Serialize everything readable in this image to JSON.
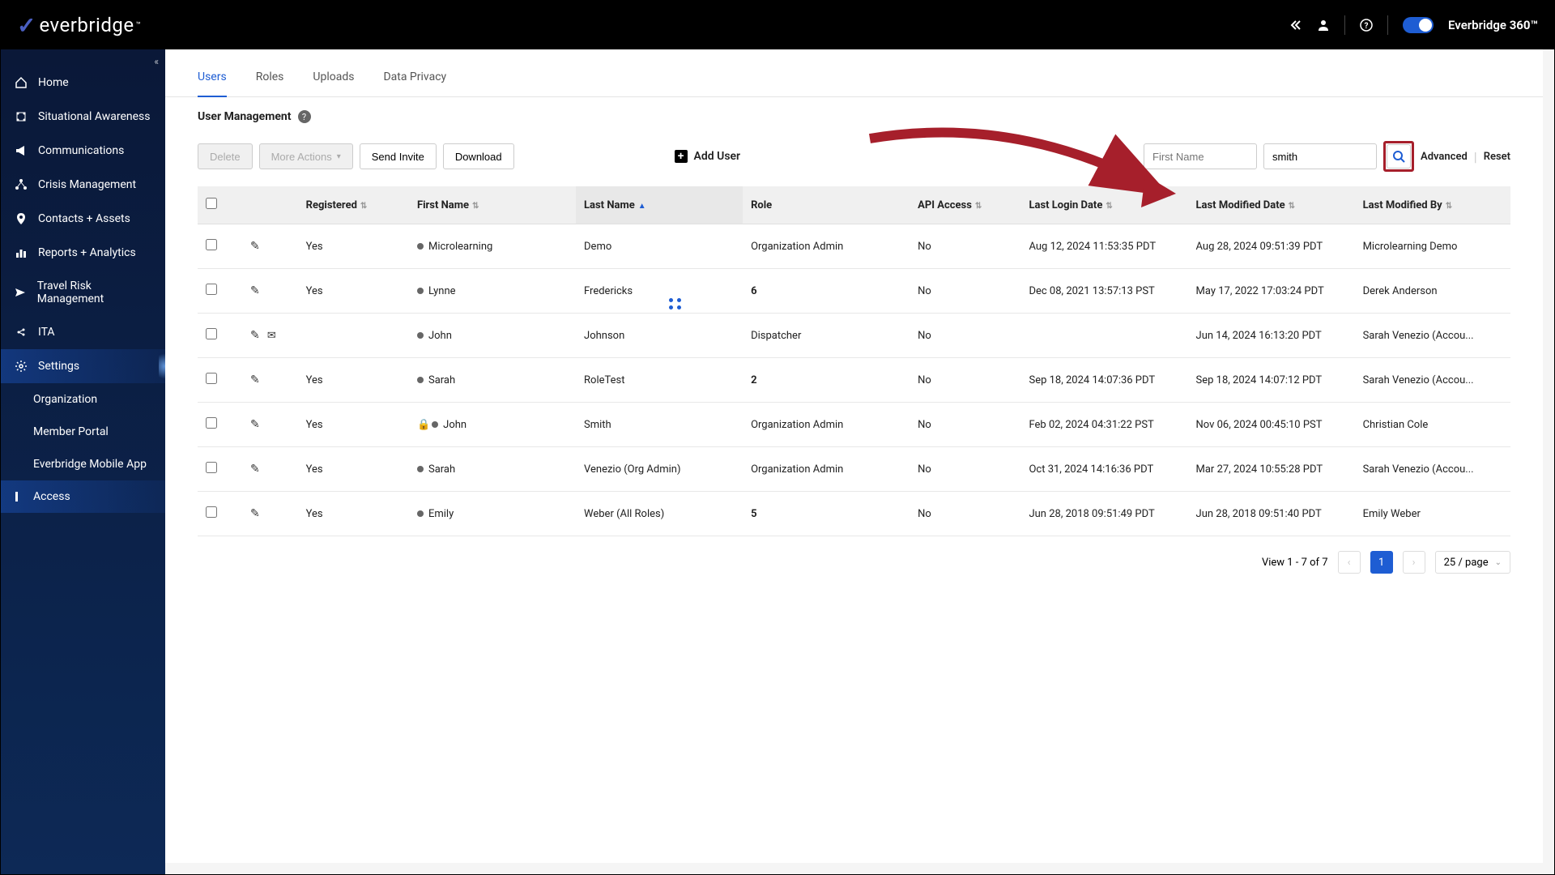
{
  "brand": {
    "name": "everbridge",
    "toggle_label": "Everbridge",
    "toggle_suffix": "360™"
  },
  "sidebar": {
    "items": [
      {
        "label": "Home",
        "icon": "home"
      },
      {
        "label": "Situational Awareness",
        "icon": "map"
      },
      {
        "label": "Communications",
        "icon": "bullhorn"
      },
      {
        "label": "Crisis Management",
        "icon": "network"
      },
      {
        "label": "Contacts + Assets",
        "icon": "pin"
      },
      {
        "label": "Reports + Analytics",
        "icon": "chart"
      },
      {
        "label": "Travel Risk Management",
        "icon": "plane"
      },
      {
        "label": "ITA",
        "icon": "link"
      },
      {
        "label": "Settings",
        "icon": "gear",
        "active": true
      }
    ],
    "subitems": [
      {
        "label": "Organization"
      },
      {
        "label": "Member Portal"
      },
      {
        "label": "Everbridge Mobile App"
      },
      {
        "label": "Access",
        "active": true
      }
    ]
  },
  "tabs": [
    {
      "label": "Users",
      "active": true
    },
    {
      "label": "Roles"
    },
    {
      "label": "Uploads"
    },
    {
      "label": "Data Privacy"
    }
  ],
  "page": {
    "title": "User Management"
  },
  "toolbar": {
    "delete": "Delete",
    "more_actions": "More Actions",
    "send_invite": "Send Invite",
    "download": "Download",
    "add_user": "Add User"
  },
  "search": {
    "first_name_placeholder": "First Name",
    "last_name_value": "smith",
    "advanced": "Advanced",
    "reset": "Reset"
  },
  "columns": {
    "registered": "Registered",
    "first_name": "First Name",
    "last_name": "Last Name",
    "role": "Role",
    "api_access": "API Access",
    "last_login": "Last Login Date",
    "last_modified": "Last Modified Date",
    "last_modified_by": "Last Modified By"
  },
  "rows": [
    {
      "registered": "Yes",
      "first_name": "Microlearning",
      "last_name": "Demo",
      "role": "Organization Admin",
      "role_bold": false,
      "api": "No",
      "login": "Aug 12, 2024 11:53:35 PDT",
      "modified": "Aug 28, 2024 09:51:39 PDT",
      "by": "Microlearning Demo",
      "envelope": false,
      "lock": false
    },
    {
      "registered": "Yes",
      "first_name": "Lynne",
      "last_name": "Fredericks",
      "role": "6",
      "role_bold": true,
      "api": "No",
      "login": "Dec 08, 2021 13:57:13 PST",
      "modified": "May 17, 2022 17:03:24 PDT",
      "by": "Derek Anderson",
      "envelope": false,
      "lock": false
    },
    {
      "registered": "",
      "first_name": "John",
      "last_name": "Johnson",
      "role": "Dispatcher",
      "role_bold": false,
      "api": "No",
      "login": "",
      "modified": "Jun 14, 2024 16:13:20 PDT",
      "by": "Sarah Venezio (Accou...",
      "envelope": true,
      "lock": false
    },
    {
      "registered": "Yes",
      "first_name": "Sarah",
      "last_name": "RoleTest",
      "role": "2",
      "role_bold": true,
      "api": "No",
      "login": "Sep 18, 2024 14:07:36 PDT",
      "modified": "Sep 18, 2024 14:07:12 PDT",
      "by": "Sarah Venezio (Accou...",
      "envelope": false,
      "lock": false
    },
    {
      "registered": "Yes",
      "first_name": "John",
      "last_name": "Smith",
      "role": "Organization Admin",
      "role_bold": false,
      "api": "No",
      "login": "Feb 02, 2024 04:31:22 PST",
      "modified": "Nov 06, 2024 00:45:10 PST",
      "by": "Christian Cole",
      "envelope": false,
      "lock": true
    },
    {
      "registered": "Yes",
      "first_name": "Sarah",
      "last_name": "Venezio (Org Admin)",
      "role": "Organization Admin",
      "role_bold": false,
      "api": "No",
      "login": "Oct 31, 2024 14:16:36 PDT",
      "modified": "Mar 27, 2024 10:55:28 PDT",
      "by": "Sarah Venezio (Accou...",
      "envelope": false,
      "lock": false
    },
    {
      "registered": "Yes",
      "first_name": "Emily",
      "last_name": "Weber (All Roles)",
      "role": "5",
      "role_bold": true,
      "api": "No",
      "login": "Jun 28, 2018 09:51:49 PDT",
      "modified": "Jun 28, 2018 09:51:40 PDT",
      "by": "Emily Weber",
      "envelope": false,
      "lock": false
    }
  ],
  "pagination": {
    "summary": "View 1 - 7 of 7",
    "current": "1",
    "page_size": "25 / page"
  }
}
